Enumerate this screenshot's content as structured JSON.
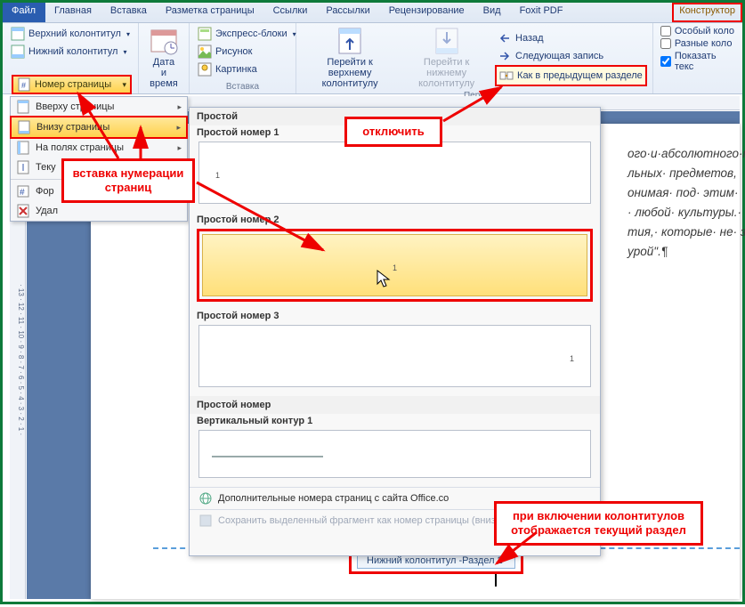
{
  "tabs": {
    "file": "Файл",
    "home": "Главная",
    "insert": "Вставка",
    "layout": "Разметка страницы",
    "refs": "Ссылки",
    "mail": "Рассылки",
    "review": "Рецензирование",
    "view": "Вид",
    "foxit": "Foxit PDF",
    "design": "Конструктор"
  },
  "ribbon": {
    "hf": {
      "header": "Верхний колонтитул",
      "footer": "Нижний колонтитул",
      "pagenum": "Номер страницы"
    },
    "datetime": {
      "label": "Дата и\nвремя"
    },
    "insert": {
      "quickparts": "Экспресс-блоки",
      "picture": "Рисунок",
      "clipart": "Картинка",
      "group": "Вставка"
    },
    "nav": {
      "gotoheader": "Перейти к верхнему\nколонтитулу",
      "gotofooter": "Перейти к нижнему\nколонтитулу",
      "back": "Назад",
      "next": "Следующая запись",
      "linkprev": "Как в предыдущем разделе",
      "group": "Пере"
    },
    "opts": {
      "special": "Особый коло",
      "diff": "Разные коло",
      "showtext": "Показать текс"
    }
  },
  "pnmenu": {
    "top": "Вверху страницы",
    "bottom": "Внизу страницы",
    "margins": "На полях страницы",
    "current": "Теку",
    "format": "Фор",
    "remove": "Удал"
  },
  "gallery": {
    "heading1": "Простой",
    "item1": "Простой номер 1",
    "item2": "Простой номер 2",
    "item3": "Простой номер 3",
    "heading2": "Простой номер",
    "item4": "Вертикальный контур 1",
    "more": "Дополнительные номера страниц с сайта Office.co",
    "save": "Сохранить выделенный фрагмент как номер страницы (внизу страницы)"
  },
  "body": {
    "l1": "ого·и·абсолютного·м",
    "l2": "льных· предметов,",
    "l3": "онимая· под· этим·",
    "l4": "· любой· культуры.·",
    "l5": "тия,· которые· не· зо",
    "l6": "урой\".¶"
  },
  "footer": {
    "tab": "Нижний колонтитул -Раздел 2-"
  },
  "callouts": {
    "c1": "вставка нумерации\nстраниц",
    "c2": "отключить",
    "c3": "при включении колонтитулов\nотображается текущий раздел"
  },
  "ruler": {
    "v": "· 13 · 12 · 11 · 10 · 9 · 8 · 7 · 6 · 5 · 4 · 3 · 2 · 1 ·"
  }
}
